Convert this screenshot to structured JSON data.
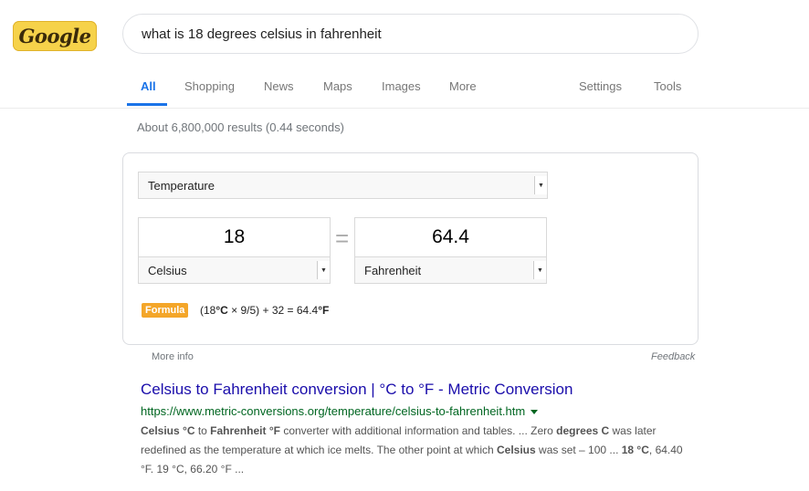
{
  "logo": {
    "text": "Google"
  },
  "search": {
    "query": "what is 18 degrees celsius in fahrenheit"
  },
  "tabs": {
    "all": "All",
    "shopping": "Shopping",
    "news": "News",
    "maps": "Maps",
    "images": "Images",
    "more": "More",
    "settings": "Settings",
    "tools": "Tools"
  },
  "stats": "About 6,800,000 results (0.44 seconds)",
  "converter": {
    "unit_type": "Temperature",
    "from_value": "18",
    "from_unit": "Celsius",
    "equals": "=",
    "to_value": "64.4",
    "to_unit": "Fahrenheit",
    "formula_label": "Formula",
    "formula_pre": "(18",
    "formula_unit1": "°C",
    "formula_mid": " × 9/5) + 32 = 64.4",
    "formula_unit2": "°F"
  },
  "card_footer": {
    "more_info": "More info",
    "feedback": "Feedback"
  },
  "result": {
    "title": "Celsius to Fahrenheit conversion | °C to °F - Metric Conversion",
    "url": "https://www.metric-conversions.org/temperature/celsius-to-fahrenheit.htm",
    "snippet": [
      {
        "t": "Celsius °C",
        "b": true
      },
      {
        "t": " to ",
        "b": false
      },
      {
        "t": "Fahrenheit °F",
        "b": true
      },
      {
        "t": " converter with additional information and tables. ... Zero ",
        "b": false
      },
      {
        "t": "degrees C",
        "b": true
      },
      {
        "t": " was later redefined as the temperature at which ice melts. The other point at which ",
        "b": false
      },
      {
        "t": "Celsius",
        "b": true
      },
      {
        "t": " was set – 100 ... ",
        "b": false
      },
      {
        "t": "18 °C",
        "b": true
      },
      {
        "t": ", 64.40 °F. 19 °C, 66.20 °F ...",
        "b": false
      }
    ]
  },
  "colors": {
    "accent": "#1a73e8",
    "link": "#1a0dab",
    "url": "#006621",
    "badge": "#f4a629"
  }
}
